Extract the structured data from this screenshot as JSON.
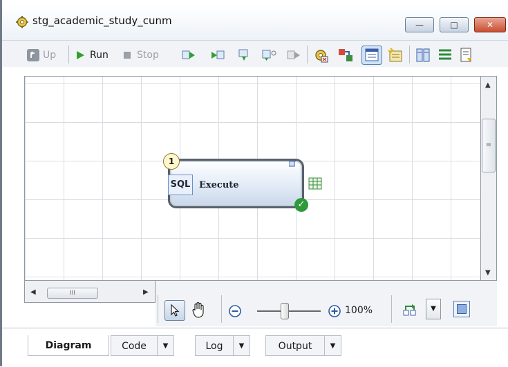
{
  "window": {
    "title": "stg_academic_study_cunm",
    "minimize_glyph": "—",
    "maximize_glyph": "□",
    "close_glyph": "✕"
  },
  "toolbar": {
    "up_label": "Up",
    "run_label": "Run",
    "stop_label": "Stop"
  },
  "canvas": {
    "node": {
      "sequence_number": "1",
      "type_label": "SQL",
      "name": "Execute",
      "status": "success"
    }
  },
  "scrollbars": {
    "hthumb_grip": "III",
    "vthumb_grip": "≡"
  },
  "zoom": {
    "level": 1.0,
    "label": "100%"
  },
  "tabs": [
    {
      "label": "Diagram",
      "active": true
    },
    {
      "label": "Code"
    },
    {
      "label": "Log"
    },
    {
      "label": "Output"
    }
  ],
  "colors": {
    "run_green": "#2ea02e",
    "success_green": "#2e9a3a",
    "close_red": "#c74e32"
  }
}
